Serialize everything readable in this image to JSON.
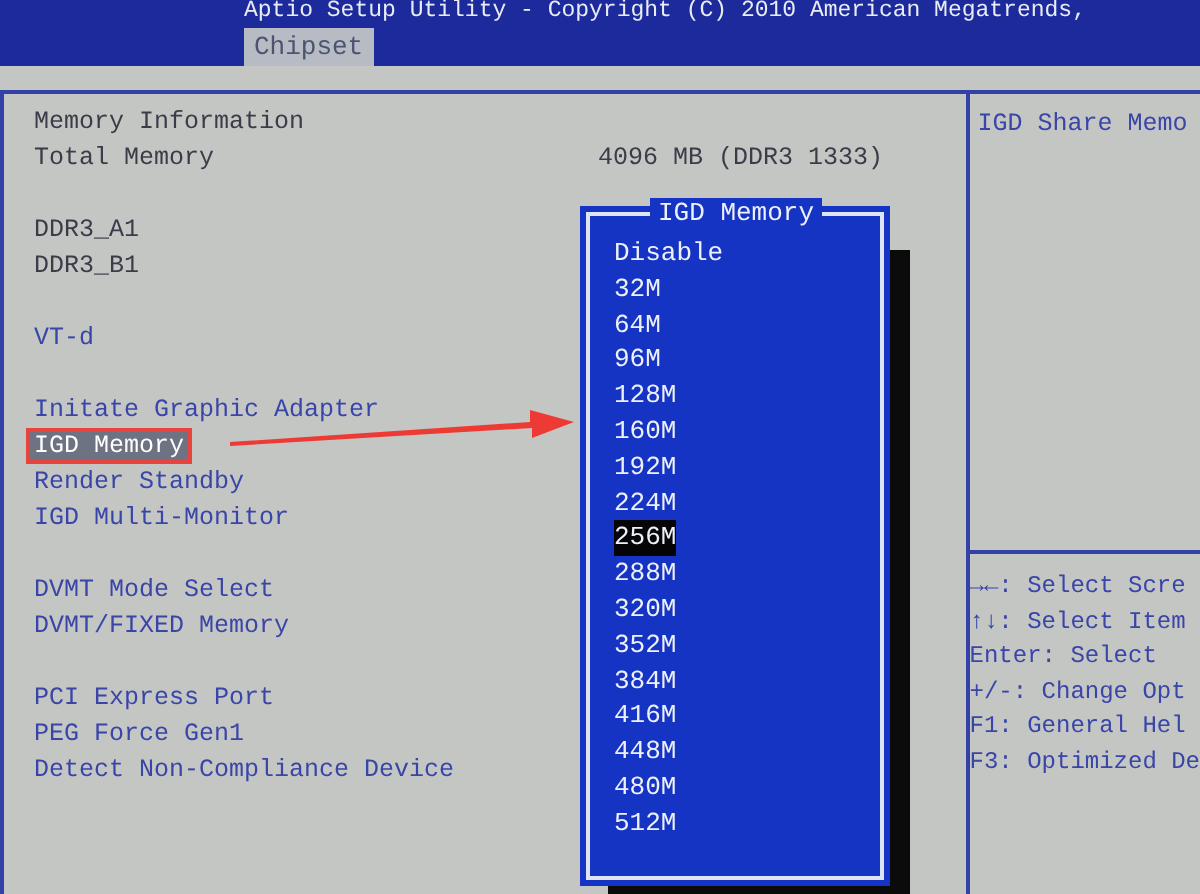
{
  "header": {
    "title": "Aptio Setup Utility - Copyright (C) 2010 American Megatrends,",
    "tabs": [
      {
        "label": "Chipset",
        "selected": true
      }
    ]
  },
  "main": {
    "groups": [
      [
        {
          "kind": "info",
          "label": "Memory Information"
        },
        {
          "kind": "info",
          "label": "Total Memory",
          "value": "4096 MB (DDR3 1333)"
        }
      ],
      [
        {
          "kind": "info",
          "label": "DDR3_A1"
        },
        {
          "kind": "info",
          "label": "DDR3_B1"
        }
      ],
      [
        {
          "kind": "setting",
          "label": "VT-d",
          "selected": false
        }
      ],
      [
        {
          "kind": "setting",
          "label": "Initate Graphic Adapter",
          "selected": false
        },
        {
          "kind": "setting",
          "label": "IGD Memory",
          "selected": true
        },
        {
          "kind": "setting",
          "label": "Render Standby",
          "selected": false
        },
        {
          "kind": "setting",
          "label": "IGD Multi-Monitor",
          "selected": false
        }
      ],
      [
        {
          "kind": "setting",
          "label": "DVMT Mode Select",
          "selected": false
        },
        {
          "kind": "setting",
          "label": "DVMT/FIXED Memory",
          "selected": false
        }
      ],
      [
        {
          "kind": "setting",
          "label": "PCI Express Port",
          "selected": false
        },
        {
          "kind": "setting",
          "label": "PEG Force Gen1",
          "selected": false
        },
        {
          "kind": "setting",
          "label": "Detect Non-Compliance Device",
          "selected": false
        }
      ]
    ]
  },
  "popup": {
    "title": "IGD Memory",
    "options": [
      {
        "label": "Disable",
        "selected": false
      },
      {
        "label": "32M",
        "selected": false
      },
      {
        "label": "64M",
        "selected": false
      },
      {
        "label": "96M",
        "selected": false
      },
      {
        "label": "128M",
        "selected": false
      },
      {
        "label": "160M",
        "selected": false
      },
      {
        "label": "192M",
        "selected": false
      },
      {
        "label": "224M",
        "selected": false
      },
      {
        "label": "256M",
        "selected": true
      },
      {
        "label": "288M",
        "selected": false
      },
      {
        "label": "320M",
        "selected": false
      },
      {
        "label": "352M",
        "selected": false
      },
      {
        "label": "384M",
        "selected": false
      },
      {
        "label": "416M",
        "selected": false
      },
      {
        "label": "448M",
        "selected": false
      },
      {
        "label": "480M",
        "selected": false
      },
      {
        "label": "512M",
        "selected": false
      }
    ]
  },
  "help": {
    "description": "IGD Share Memo",
    "keys": [
      "→←: Select Scre",
      "↑↓: Select Item",
      "Enter: Select",
      "+/-: Change Opt",
      "F1: General Hel",
      "F3: Optimized De"
    ]
  }
}
